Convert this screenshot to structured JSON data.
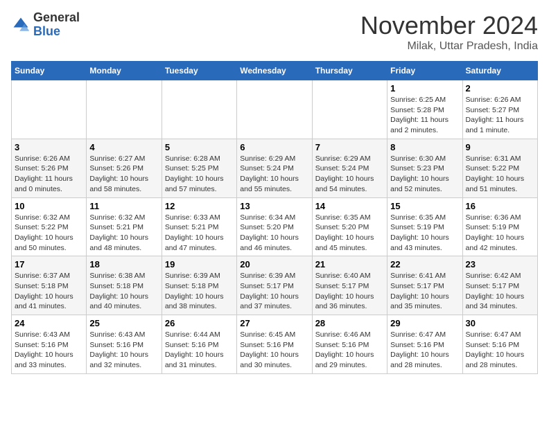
{
  "logo": {
    "general": "General",
    "blue": "Blue"
  },
  "title": "November 2024",
  "subtitle": "Milak, Uttar Pradesh, India",
  "weekdays": [
    "Sunday",
    "Monday",
    "Tuesday",
    "Wednesday",
    "Thursday",
    "Friday",
    "Saturday"
  ],
  "weeks": [
    [
      {
        "day": "",
        "info": ""
      },
      {
        "day": "",
        "info": ""
      },
      {
        "day": "",
        "info": ""
      },
      {
        "day": "",
        "info": ""
      },
      {
        "day": "",
        "info": ""
      },
      {
        "day": "1",
        "info": "Sunrise: 6:25 AM\nSunset: 5:28 PM\nDaylight: 11 hours and 2 minutes."
      },
      {
        "day": "2",
        "info": "Sunrise: 6:26 AM\nSunset: 5:27 PM\nDaylight: 11 hours and 1 minute."
      }
    ],
    [
      {
        "day": "3",
        "info": "Sunrise: 6:26 AM\nSunset: 5:26 PM\nDaylight: 11 hours and 0 minutes."
      },
      {
        "day": "4",
        "info": "Sunrise: 6:27 AM\nSunset: 5:26 PM\nDaylight: 10 hours and 58 minutes."
      },
      {
        "day": "5",
        "info": "Sunrise: 6:28 AM\nSunset: 5:25 PM\nDaylight: 10 hours and 57 minutes."
      },
      {
        "day": "6",
        "info": "Sunrise: 6:29 AM\nSunset: 5:24 PM\nDaylight: 10 hours and 55 minutes."
      },
      {
        "day": "7",
        "info": "Sunrise: 6:29 AM\nSunset: 5:24 PM\nDaylight: 10 hours and 54 minutes."
      },
      {
        "day": "8",
        "info": "Sunrise: 6:30 AM\nSunset: 5:23 PM\nDaylight: 10 hours and 52 minutes."
      },
      {
        "day": "9",
        "info": "Sunrise: 6:31 AM\nSunset: 5:22 PM\nDaylight: 10 hours and 51 minutes."
      }
    ],
    [
      {
        "day": "10",
        "info": "Sunrise: 6:32 AM\nSunset: 5:22 PM\nDaylight: 10 hours and 50 minutes."
      },
      {
        "day": "11",
        "info": "Sunrise: 6:32 AM\nSunset: 5:21 PM\nDaylight: 10 hours and 48 minutes."
      },
      {
        "day": "12",
        "info": "Sunrise: 6:33 AM\nSunset: 5:21 PM\nDaylight: 10 hours and 47 minutes."
      },
      {
        "day": "13",
        "info": "Sunrise: 6:34 AM\nSunset: 5:20 PM\nDaylight: 10 hours and 46 minutes."
      },
      {
        "day": "14",
        "info": "Sunrise: 6:35 AM\nSunset: 5:20 PM\nDaylight: 10 hours and 45 minutes."
      },
      {
        "day": "15",
        "info": "Sunrise: 6:35 AM\nSunset: 5:19 PM\nDaylight: 10 hours and 43 minutes."
      },
      {
        "day": "16",
        "info": "Sunrise: 6:36 AM\nSunset: 5:19 PM\nDaylight: 10 hours and 42 minutes."
      }
    ],
    [
      {
        "day": "17",
        "info": "Sunrise: 6:37 AM\nSunset: 5:18 PM\nDaylight: 10 hours and 41 minutes."
      },
      {
        "day": "18",
        "info": "Sunrise: 6:38 AM\nSunset: 5:18 PM\nDaylight: 10 hours and 40 minutes."
      },
      {
        "day": "19",
        "info": "Sunrise: 6:39 AM\nSunset: 5:18 PM\nDaylight: 10 hours and 38 minutes."
      },
      {
        "day": "20",
        "info": "Sunrise: 6:39 AM\nSunset: 5:17 PM\nDaylight: 10 hours and 37 minutes."
      },
      {
        "day": "21",
        "info": "Sunrise: 6:40 AM\nSunset: 5:17 PM\nDaylight: 10 hours and 36 minutes."
      },
      {
        "day": "22",
        "info": "Sunrise: 6:41 AM\nSunset: 5:17 PM\nDaylight: 10 hours and 35 minutes."
      },
      {
        "day": "23",
        "info": "Sunrise: 6:42 AM\nSunset: 5:17 PM\nDaylight: 10 hours and 34 minutes."
      }
    ],
    [
      {
        "day": "24",
        "info": "Sunrise: 6:43 AM\nSunset: 5:16 PM\nDaylight: 10 hours and 33 minutes."
      },
      {
        "day": "25",
        "info": "Sunrise: 6:43 AM\nSunset: 5:16 PM\nDaylight: 10 hours and 32 minutes."
      },
      {
        "day": "26",
        "info": "Sunrise: 6:44 AM\nSunset: 5:16 PM\nDaylight: 10 hours and 31 minutes."
      },
      {
        "day": "27",
        "info": "Sunrise: 6:45 AM\nSunset: 5:16 PM\nDaylight: 10 hours and 30 minutes."
      },
      {
        "day": "28",
        "info": "Sunrise: 6:46 AM\nSunset: 5:16 PM\nDaylight: 10 hours and 29 minutes."
      },
      {
        "day": "29",
        "info": "Sunrise: 6:47 AM\nSunset: 5:16 PM\nDaylight: 10 hours and 28 minutes."
      },
      {
        "day": "30",
        "info": "Sunrise: 6:47 AM\nSunset: 5:16 PM\nDaylight: 10 hours and 28 minutes."
      }
    ]
  ]
}
